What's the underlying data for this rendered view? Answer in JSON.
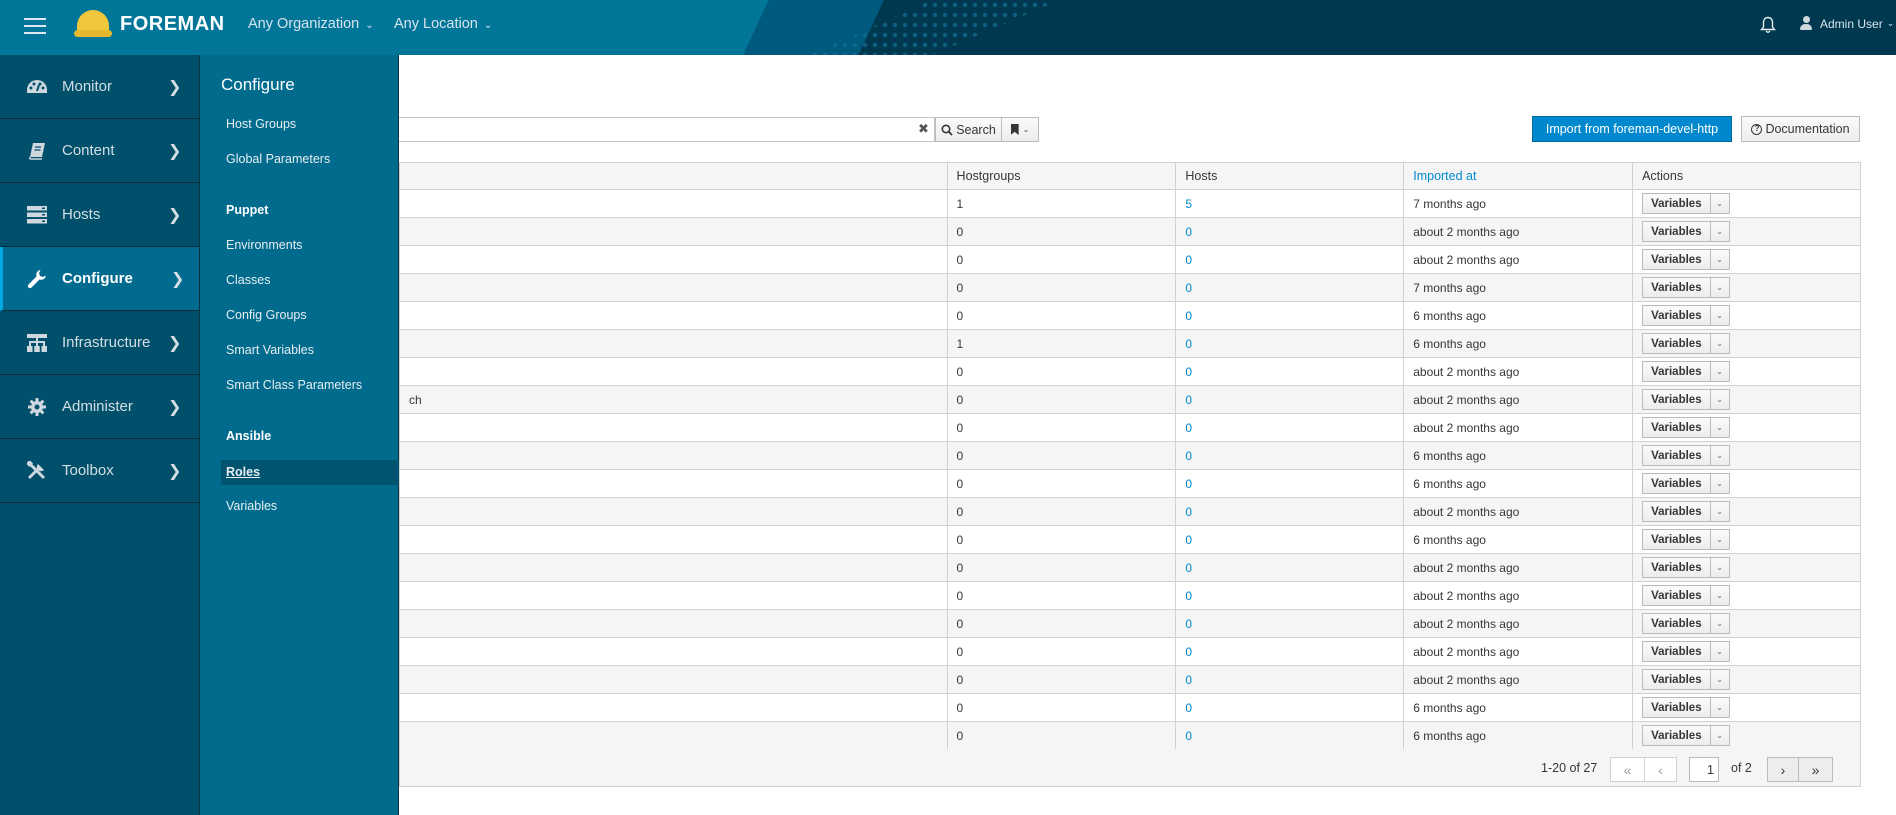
{
  "topbar": {
    "brand": "FOREMAN",
    "organization": "Any Organization",
    "location": "Any Location",
    "user": "Admin User"
  },
  "nav": {
    "items": [
      {
        "label": "Monitor",
        "icon": "dashboard-icon"
      },
      {
        "label": "Content",
        "icon": "book-icon"
      },
      {
        "label": "Hosts",
        "icon": "server-icon"
      },
      {
        "label": "Configure",
        "icon": "wrench-icon",
        "active": true
      },
      {
        "label": "Infrastructure",
        "icon": "sitemap-icon"
      },
      {
        "label": "Administer",
        "icon": "gear-icon"
      },
      {
        "label": "Toolbox",
        "icon": "tools-icon"
      }
    ]
  },
  "subnav": {
    "title": "Configure",
    "items": [
      {
        "label": "Host Groups"
      },
      {
        "label": "Global Parameters"
      },
      {
        "label": "Puppet",
        "header": true
      },
      {
        "label": "Environments"
      },
      {
        "label": "Classes"
      },
      {
        "label": "Config Groups"
      },
      {
        "label": "Smart Variables"
      },
      {
        "label": "Smart Class Parameters"
      },
      {
        "label": "Ansible",
        "header": true
      },
      {
        "label": "Roles",
        "active": true
      },
      {
        "label": "Variables"
      }
    ]
  },
  "search": {
    "value": "",
    "search_label": "Search"
  },
  "actions": {
    "import_label": "Import from foreman-devel-http",
    "documentation_label": "Documentation"
  },
  "table": {
    "columns": [
      "",
      "Hostgroups",
      "Hosts",
      "Imported at",
      "Actions"
    ],
    "rows": [
      {
        "name": "",
        "hostgroups": "1",
        "hosts": "5",
        "imported": "7 months ago",
        "action": "Variables"
      },
      {
        "name": "",
        "hostgroups": "0",
        "hosts": "0",
        "imported": "about 2 months ago",
        "action": "Variables"
      },
      {
        "name": "",
        "hostgroups": "0",
        "hosts": "0",
        "imported": "about 2 months ago",
        "action": "Variables"
      },
      {
        "name": "",
        "hostgroups": "0",
        "hosts": "0",
        "imported": "7 months ago",
        "action": "Variables"
      },
      {
        "name": "",
        "hostgroups": "0",
        "hosts": "0",
        "imported": "6 months ago",
        "action": "Variables"
      },
      {
        "name": "",
        "hostgroups": "1",
        "hosts": "0",
        "imported": "6 months ago",
        "action": "Variables"
      },
      {
        "name": "",
        "hostgroups": "0",
        "hosts": "0",
        "imported": "about 2 months ago",
        "action": "Variables"
      },
      {
        "name": "ch",
        "hostgroups": "0",
        "hosts": "0",
        "imported": "about 2 months ago",
        "action": "Variables"
      },
      {
        "name": "",
        "hostgroups": "0",
        "hosts": "0",
        "imported": "about 2 months ago",
        "action": "Variables"
      },
      {
        "name": "",
        "hostgroups": "0",
        "hosts": "0",
        "imported": "6 months ago",
        "action": "Variables"
      },
      {
        "name": "",
        "hostgroups": "0",
        "hosts": "0",
        "imported": "6 months ago",
        "action": "Variables"
      },
      {
        "name": "",
        "hostgroups": "0",
        "hosts": "0",
        "imported": "about 2 months ago",
        "action": "Variables"
      },
      {
        "name": "",
        "hostgroups": "0",
        "hosts": "0",
        "imported": "6 months ago",
        "action": "Variables"
      },
      {
        "name": "",
        "hostgroups": "0",
        "hosts": "0",
        "imported": "about 2 months ago",
        "action": "Variables"
      },
      {
        "name": "",
        "hostgroups": "0",
        "hosts": "0",
        "imported": "about 2 months ago",
        "action": "Variables"
      },
      {
        "name": "",
        "hostgroups": "0",
        "hosts": "0",
        "imported": "about 2 months ago",
        "action": "Variables"
      },
      {
        "name": "",
        "hostgroups": "0",
        "hosts": "0",
        "imported": "about 2 months ago",
        "action": "Variables"
      },
      {
        "name": "",
        "hostgroups": "0",
        "hosts": "0",
        "imported": "about 2 months ago",
        "action": "Variables"
      },
      {
        "name": "",
        "hostgroups": "0",
        "hosts": "0",
        "imported": "6 months ago",
        "action": "Variables"
      },
      {
        "name": "",
        "hostgroups": "0",
        "hosts": "0",
        "imported": "6 months ago",
        "action": "Variables"
      }
    ]
  },
  "pagination": {
    "range": "1-20 of  27",
    "current_page": "1",
    "of_pages": "of  2",
    "first": "«",
    "prev": "‹",
    "next": "›",
    "last": "»"
  },
  "colors": {
    "accent": "#0088ce",
    "nav_bg": "#00506b",
    "subnav_bg": "#006b8d",
    "topbar": "#027699"
  }
}
